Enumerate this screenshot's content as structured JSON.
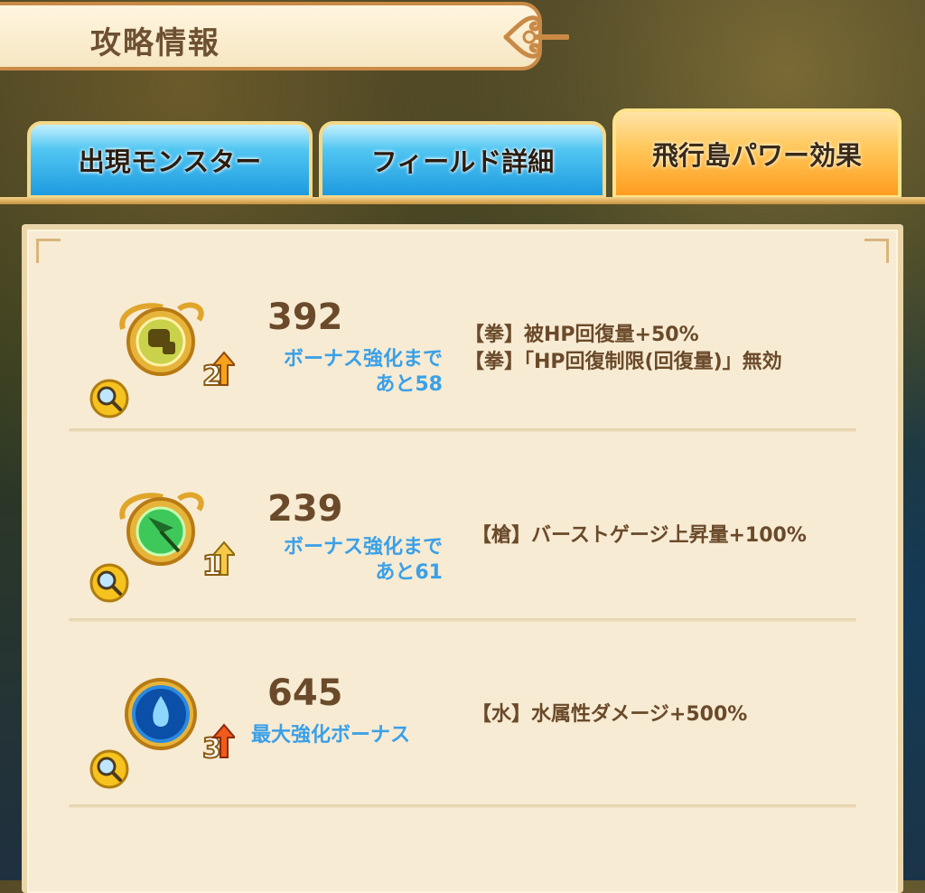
{
  "header": {
    "title": "攻略情報"
  },
  "tabs": [
    {
      "label": "出現モンスター",
      "active": false
    },
    {
      "label": "フィールド詳細",
      "active": false
    },
    {
      "label": "飛行島パワー効果",
      "active": true
    }
  ],
  "powers": [
    {
      "icon": "fist-rune-icon",
      "level": "2",
      "value": "392",
      "bonus_line1": "ボーナス強化まで",
      "bonus_line2": "あと58",
      "effects": [
        "【拳】被HP回復量+50%",
        "【拳】「HP回復制限(回復量)」無効"
      ]
    },
    {
      "icon": "spear-rune-icon",
      "level": "1",
      "value": "239",
      "bonus_line1": "ボーナス強化まで",
      "bonus_line2": "あと61",
      "effects": [
        "【槍】バーストゲージ上昇量+100%"
      ]
    },
    {
      "icon": "water-rune-icon",
      "level": "3",
      "value": "645",
      "bonus_line1": "最大強化ボーナス",
      "bonus_line2": "",
      "effects": [
        "【水】水属性ダメージ+500%"
      ]
    }
  ],
  "colors": {
    "accent_blue": "#3aa0e8",
    "text_brown": "#6a4a2a",
    "active_tab": "#ffb640"
  }
}
